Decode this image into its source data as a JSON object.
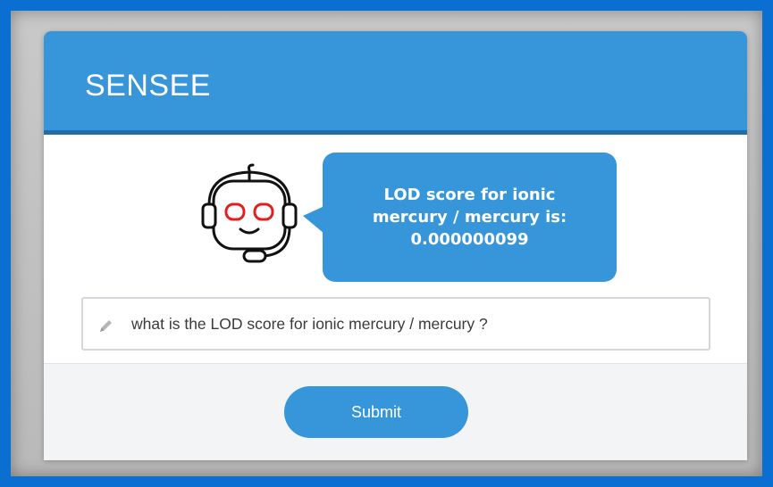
{
  "app": {
    "title": "SENSEE"
  },
  "chat": {
    "bot_response": "LOD score for ionic mercury / mercury is: 0.000000099",
    "bot_avatar_icon": "robot-headset-icon"
  },
  "query": {
    "value": "what is the LOD score for ionic mercury / mercury ?",
    "icon": "pencil-icon"
  },
  "actions": {
    "submit_label": "Submit"
  },
  "colors": {
    "outer_frame": "#0a6fd0",
    "header_bg": "#3796d9",
    "header_border": "#1f6ea8",
    "bubble_bg": "#3796d9",
    "button_bg": "#3796d9",
    "robot_eyes": "#e02020",
    "footer_bg": "#f3f4f6"
  }
}
